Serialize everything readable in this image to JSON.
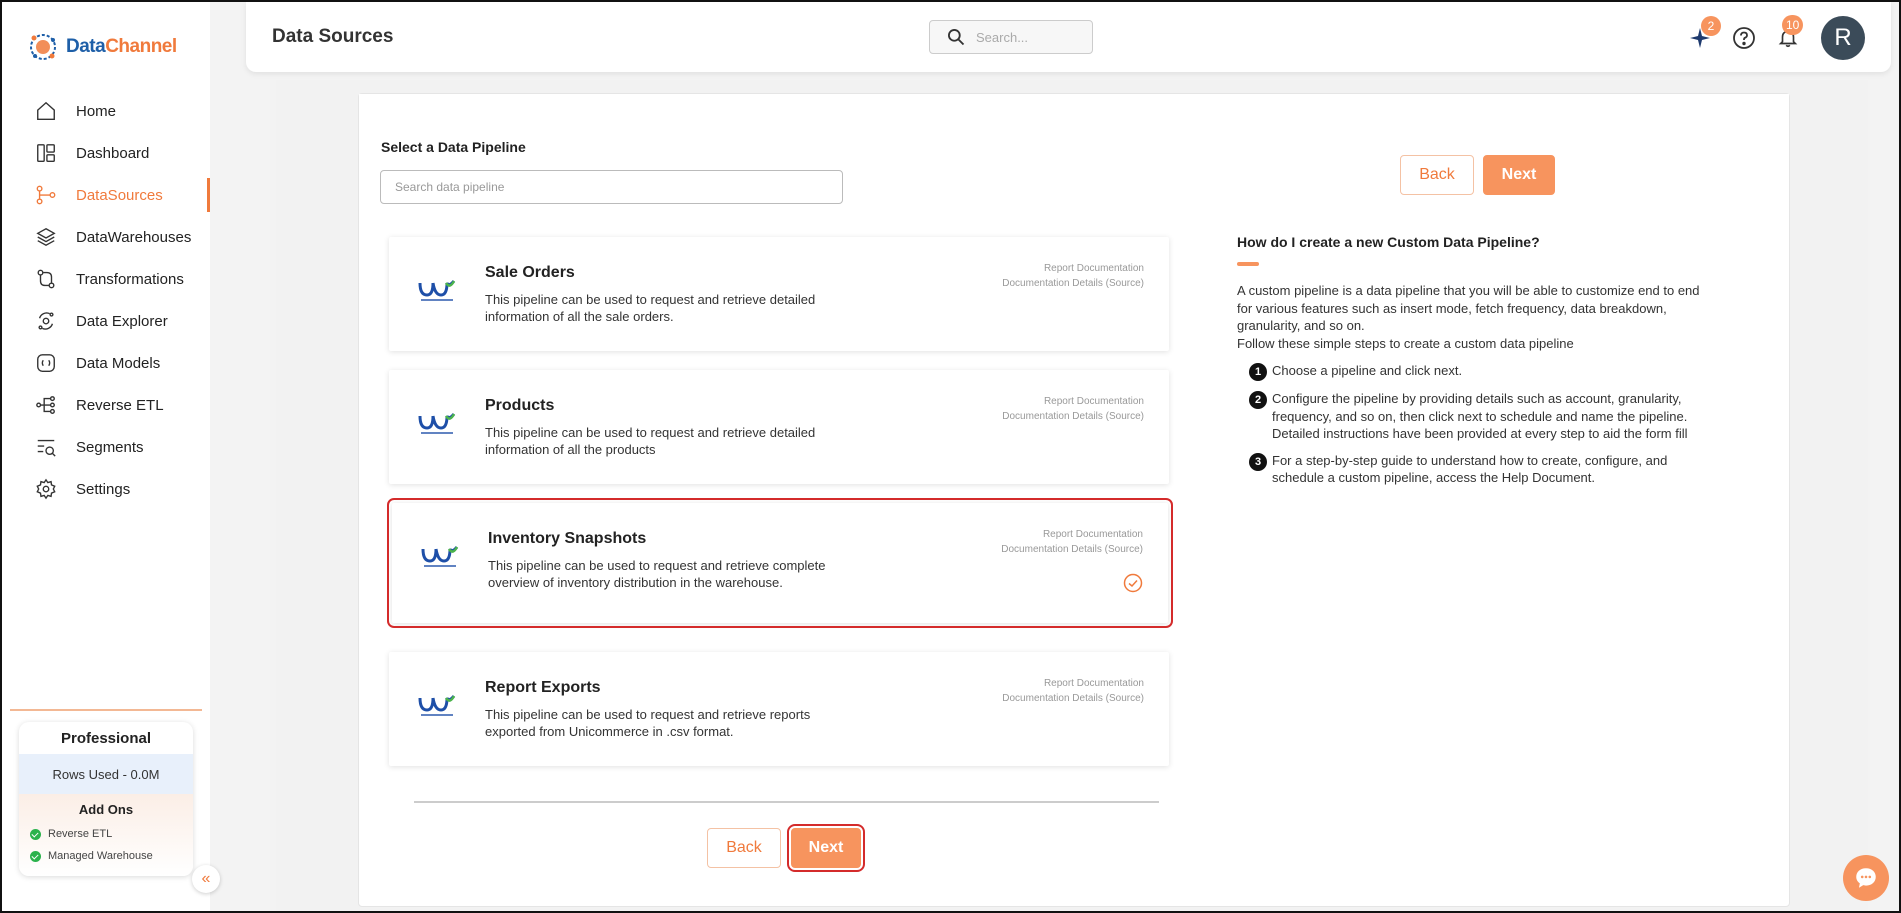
{
  "brand": {
    "name_part1": "Data",
    "name_part2": "Channel"
  },
  "sidebar": {
    "items": [
      {
        "label": "Home",
        "icon": "home-icon"
      },
      {
        "label": "Dashboard",
        "icon": "dashboard-icon"
      },
      {
        "label": "DataSources",
        "icon": "datasources-icon",
        "active": true
      },
      {
        "label": "DataWarehouses",
        "icon": "layers-icon"
      },
      {
        "label": "Transformations",
        "icon": "transformations-icon"
      },
      {
        "label": "Data Explorer",
        "icon": "explorer-icon"
      },
      {
        "label": "Data Models",
        "icon": "models-icon"
      },
      {
        "label": "Reverse ETL",
        "icon": "reverse-etl-icon"
      },
      {
        "label": "Segments",
        "icon": "segments-icon"
      },
      {
        "label": "Settings",
        "icon": "gear-icon"
      }
    ],
    "plan": {
      "title": "Professional",
      "rows_used": "Rows Used - 0.0M",
      "addons_title": "Add Ons",
      "addons": [
        "Reverse ETL",
        "Managed Warehouse"
      ]
    },
    "collapse_glyph": "«"
  },
  "header": {
    "title": "Data Sources",
    "search_placeholder": "Search...",
    "sparkle_badge": "2",
    "notification_badge": "10",
    "avatar_initial": "R"
  },
  "main": {
    "select_label": "Select a Data Pipeline",
    "pipeline_search_placeholder": "Search data pipeline",
    "back_label": "Back",
    "next_label": "Next",
    "pipelines": [
      {
        "name": "Sale Orders",
        "description": "This pipeline can be used to request and retrieve detailed information of all the sale orders.",
        "link1": "Report Documentation",
        "link2": "Documentation Details (Source)"
      },
      {
        "name": "Products",
        "description": "This pipeline can be used to request and retrieve detailed information of all the products",
        "link1": "Report Documentation",
        "link2": "Documentation Details (Source)"
      },
      {
        "name": "Inventory Snapshots",
        "description": "This pipeline can be used to request and retrieve complete overview of inventory distribution in the warehouse.",
        "link1": "Report Documentation",
        "link2": "Documentation Details (Source)",
        "selected": true
      },
      {
        "name": "Report Exports",
        "description": "This pipeline can be used to request and retrieve reports exported from Unicommerce in .csv format.",
        "link1": "Report Documentation",
        "link2": "Documentation Details (Source)"
      }
    ]
  },
  "help": {
    "title": "How do I create a new Custom Data Pipeline?",
    "intro1": "A custom pipeline is a data pipeline that you will be able to customize end to end for various features such as insert mode, fetch frequency, data breakdown, granularity, and so on.",
    "intro2": "Follow these simple steps to create a custom data pipeline",
    "steps": [
      {
        "num": "1",
        "text": "Choose a pipeline and click next."
      },
      {
        "num": "2",
        "text": "Configure the pipeline by providing details such as account, granularity, frequency, and so on, then click next to schedule and name the pipeline. Detailed instructions have been provided at every step to aid the form fill"
      },
      {
        "num": "3",
        "text": "For a step-by-step guide to understand how to create, configure, and schedule a custom pipeline, access the Help Document."
      }
    ]
  },
  "colors": {
    "accent": "#f7945e",
    "brand_blue": "#1e5fa8",
    "highlight": "#d42b2b"
  }
}
